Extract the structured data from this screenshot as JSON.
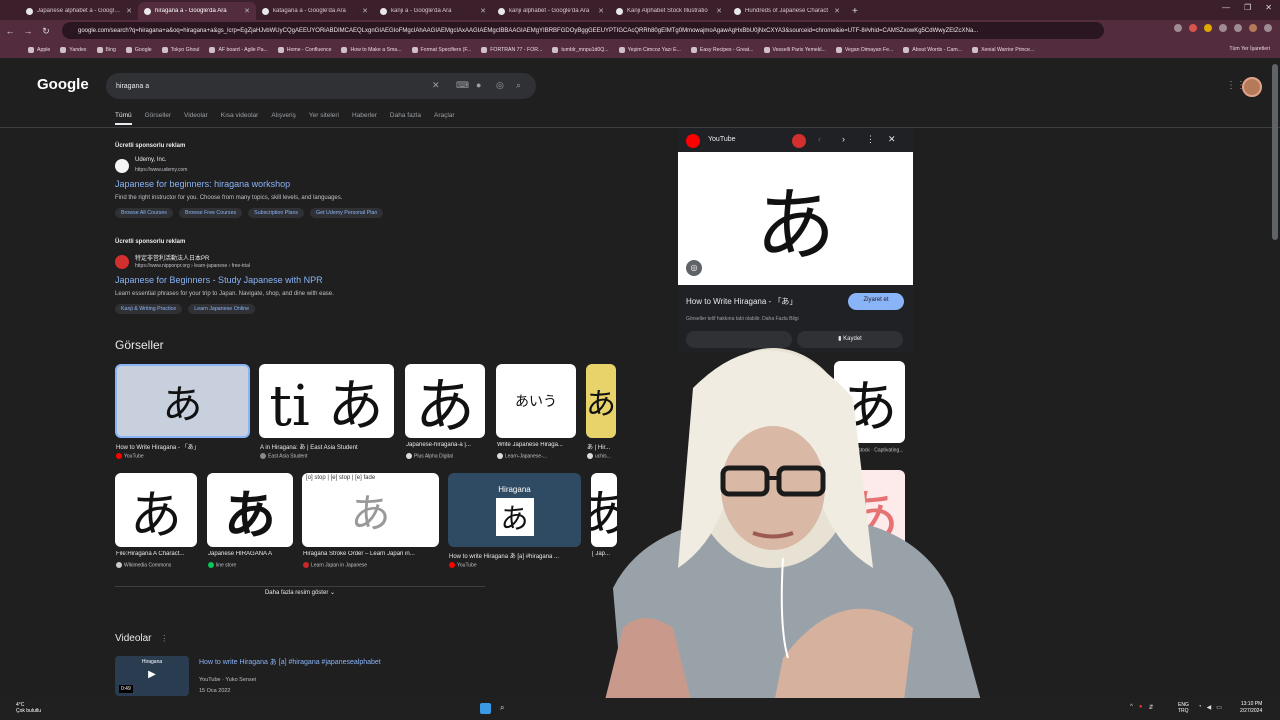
{
  "tabs": [
    {
      "title": "Japanese alphabet a - Google'da Ara",
      "active": false
    },
    {
      "title": "hiragana a - Google'da Ara",
      "active": true
    },
    {
      "title": "katagana a - Google'da Ara",
      "active": false
    },
    {
      "title": "kanji a - Google'da Ara",
      "active": false
    },
    {
      "title": "kanji alphabet - Google'da Ara",
      "active": false
    },
    {
      "title": "Kanji Alphabet Stock Illustratio",
      "active": false
    },
    {
      "title": "Hundreds of Japanese Charact",
      "active": false
    }
  ],
  "toolbar": {
    "url": "google.com/search?q=hiragana+a&oq=hiragana+a&gs_lcrp=EgZjaHJvbWUyCQgAEEUYORiABDIMCAEQLxgnGIAEGIoFMgcIAhAAGIAEMgcIAxAAGIAEMgcIBBAAGIAEMgYIBRBFGDOyBggGEEUYPTIGCAcQRRh80gEIMTg0MmowajmoAgawAgHxBbU0jNxCXYA3&sourceid=chrome&ie=UTF-8#vhid=CAMSZxowKg5CdWwyZEtZcXNa..."
  },
  "bookmarks": [
    "Apple",
    "Yandex",
    "Bing",
    "Google",
    "Tokyo Ghoul",
    "AF board - Agile Pa...",
    "Home - Confluence",
    "How to Make a Sma...",
    "Format Specifiers (F...",
    "FORTRAN 77 - FOR...",
    "tumblr_mnpu1d0Q...",
    "Yeşim Cimcoz Yazı E...",
    "Easy Recipes - Great...",
    "Vesselli Paris Yemekl...",
    "Vegan Dimayan Fe...",
    "About Words - Cam...",
    "Xenial Warrior Prince..."
  ],
  "bookmarks_right": "Tüm Yer İşaretleri",
  "google": {
    "logo": "Google",
    "query": "hiragana a",
    "tabs": [
      "Tümü",
      "Görseller",
      "Videolar",
      "Kısa videolar",
      "Alışveriş",
      "Yer siteleri",
      "Haberler",
      "Daha fazla",
      "Araçlar"
    ]
  },
  "ads": [
    {
      "head": "Ücretli sponsorlu reklam",
      "site": "Udemy, Inc.",
      "url": "https://www.udemy.com",
      "title": "Japanese for beginners: hiragana workshop",
      "desc": "Find the right instructor for you. Choose from many topics, skill levels, and languages.",
      "links": [
        "Browse All Courses",
        "Browse Free Courses",
        "Subscription Plans",
        "Get Udemy Personal Plan"
      ]
    },
    {
      "head": "Ücretli sponsorlu reklam",
      "site": "特定非営利活動法人日本PR",
      "url": "https://www.nipponpr.org › learn-japanese › free-trial",
      "title": "Japanese for Beginners - Study Japanese with NPR",
      "desc": "Learn essential phrases for your trip to Japan. Navigate, shop, and dine with ease.",
      "links": [
        "Kanji & Writing Practice",
        "Learn Japanese Online"
      ]
    }
  ],
  "images": {
    "heading": "Görseller",
    "row1": [
      {
        "glyph": "あ",
        "caption": "How to Write Hiragana - 「あ」",
        "source": "YouTube"
      },
      {
        "glyph": "ti あ",
        "caption": "A in Hiragana: あ | East Asia Student",
        "source": "East Asia Student"
      },
      {
        "glyph": "あ",
        "caption": "Japanese-hiragana-a |...",
        "source": "Plus Alpha Digital"
      },
      {
        "glyph": "あいう",
        "caption": "Write Japanese Hiraga...",
        "source": "Learn-Japanese-..."
      },
      {
        "glyph": "あ",
        "caption": "あ | Hir...",
        "source": "uchis..."
      },
      {
        "glyph": "あ",
        "caption": "",
        "source": "Shutterstock · Captivating..."
      }
    ],
    "row2": [
      {
        "glyph": "あ",
        "caption": "File:Hiragana A Charact...",
        "source": "Wikimedia Commons"
      },
      {
        "glyph": "あ",
        "caption": "Japanese HIRAGANA A",
        "source": "line store"
      },
      {
        "glyph": "あ",
        "caption": "Hiragana Stroke Order – Learn Japan in...",
        "source": "Learn Japan in Japanese",
        "labels": "[o] stop | [e] stop | [e] fade"
      },
      {
        "glyph": "あ",
        "caption": "How to write Hiragana あ [a] #hiragana ...",
        "source": "YouTube",
        "label": "Hiragana"
      },
      {
        "glyph": "あ",
        "caption": "[ Jap...",
        "source": ""
      }
    ],
    "more": "Daha fazla resim göster"
  },
  "videos": {
    "heading": "Videolar",
    "title": "How to write Hiragana あ [a] #hiragana #japanesealphabet",
    "source": "YouTube · Yuko Sensei",
    "date": "15 Oca 2022",
    "duration": "0:49",
    "thumb_label": "Hiragana"
  },
  "panel": {
    "source": "YouTube",
    "glyph": "あ",
    "title": "How to Write Hiragana - 「あ」",
    "visit": "Ziyaret et",
    "note": "Görseller telif hakkına tabi olabilir. Daha Fazla Bilgi",
    "save": "Kaydet"
  },
  "taskbar": {
    "weather_temp": "4°C",
    "weather_desc": "Çok bulutlu",
    "lang1": "ENG",
    "lang2": "TRQ",
    "time": "13:10 PM",
    "date": "2/27/2024"
  }
}
